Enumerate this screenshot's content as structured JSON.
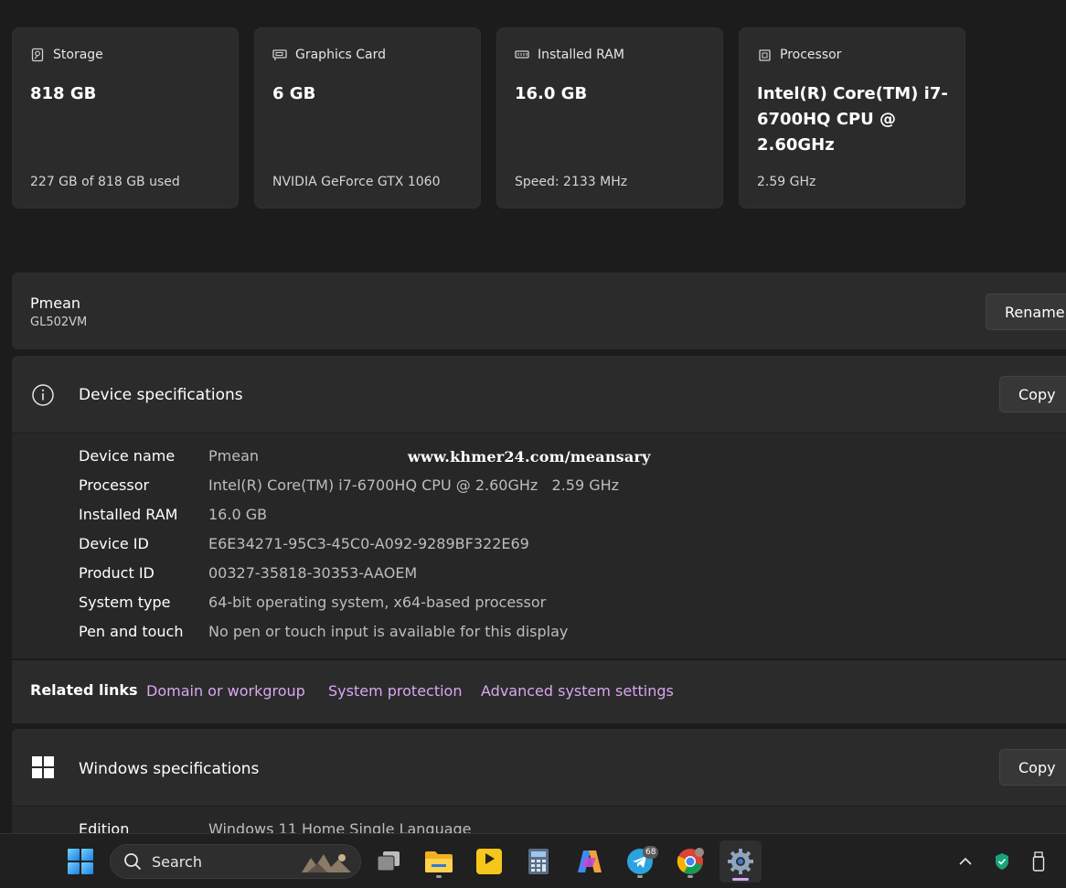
{
  "cards": [
    {
      "label": "Storage",
      "value": "818 GB",
      "sub": "227 GB of 818 GB used",
      "icon": "storage-icon"
    },
    {
      "label": "Graphics Card",
      "value": "6 GB",
      "sub": "NVIDIA GeForce GTX 1060",
      "icon": "graphics-card-icon"
    },
    {
      "label": "Installed RAM",
      "value": "16.0 GB",
      "sub": "Speed: 2133 MHz",
      "icon": "ram-icon"
    },
    {
      "label": "Processor",
      "value": "Intel(R) Core(TM) i7-6700HQ CPU @ 2.60GHz",
      "sub": "2.59 GHz",
      "icon": "processor-icon"
    }
  ],
  "device": {
    "name": "Pmean",
    "model": "GL502VM",
    "rename_label": "Rename"
  },
  "device_specs": {
    "title": "Device specifications",
    "copy_label": "Copy",
    "rows": [
      {
        "key": "Device name",
        "value": "Pmean"
      },
      {
        "key": "Processor",
        "value": "Intel(R) Core(TM) i7-6700HQ CPU @ 2.60GHz   2.59 GHz"
      },
      {
        "key": "Installed RAM",
        "value": "16.0 GB"
      },
      {
        "key": "Device ID",
        "value": "E6E34271-95C3-45C0-A092-9289BF322E69"
      },
      {
        "key": "Product ID",
        "value": "00327-35818-30353-AAOEM"
      },
      {
        "key": "System type",
        "value": "64-bit operating system, x64-based processor"
      },
      {
        "key": "Pen and touch",
        "value": "No pen or touch input is available for this display"
      }
    ]
  },
  "watermark": "www.khmer24.com/meansary",
  "related_links": {
    "title": "Related links",
    "links": [
      "Domain or workgroup",
      "System protection",
      "Advanced system settings"
    ]
  },
  "windows_specs": {
    "title": "Windows specifications",
    "copy_label": "Copy",
    "rows": [
      {
        "key": "Edition",
        "value": "Windows 11 Home Single Language"
      }
    ]
  },
  "taskbar": {
    "search_label": "Search",
    "telegram_badge": "68"
  },
  "colors": {
    "accent_link": "#d9a6f0",
    "background": "#1c1c1c",
    "card": "#2b2b2b"
  }
}
